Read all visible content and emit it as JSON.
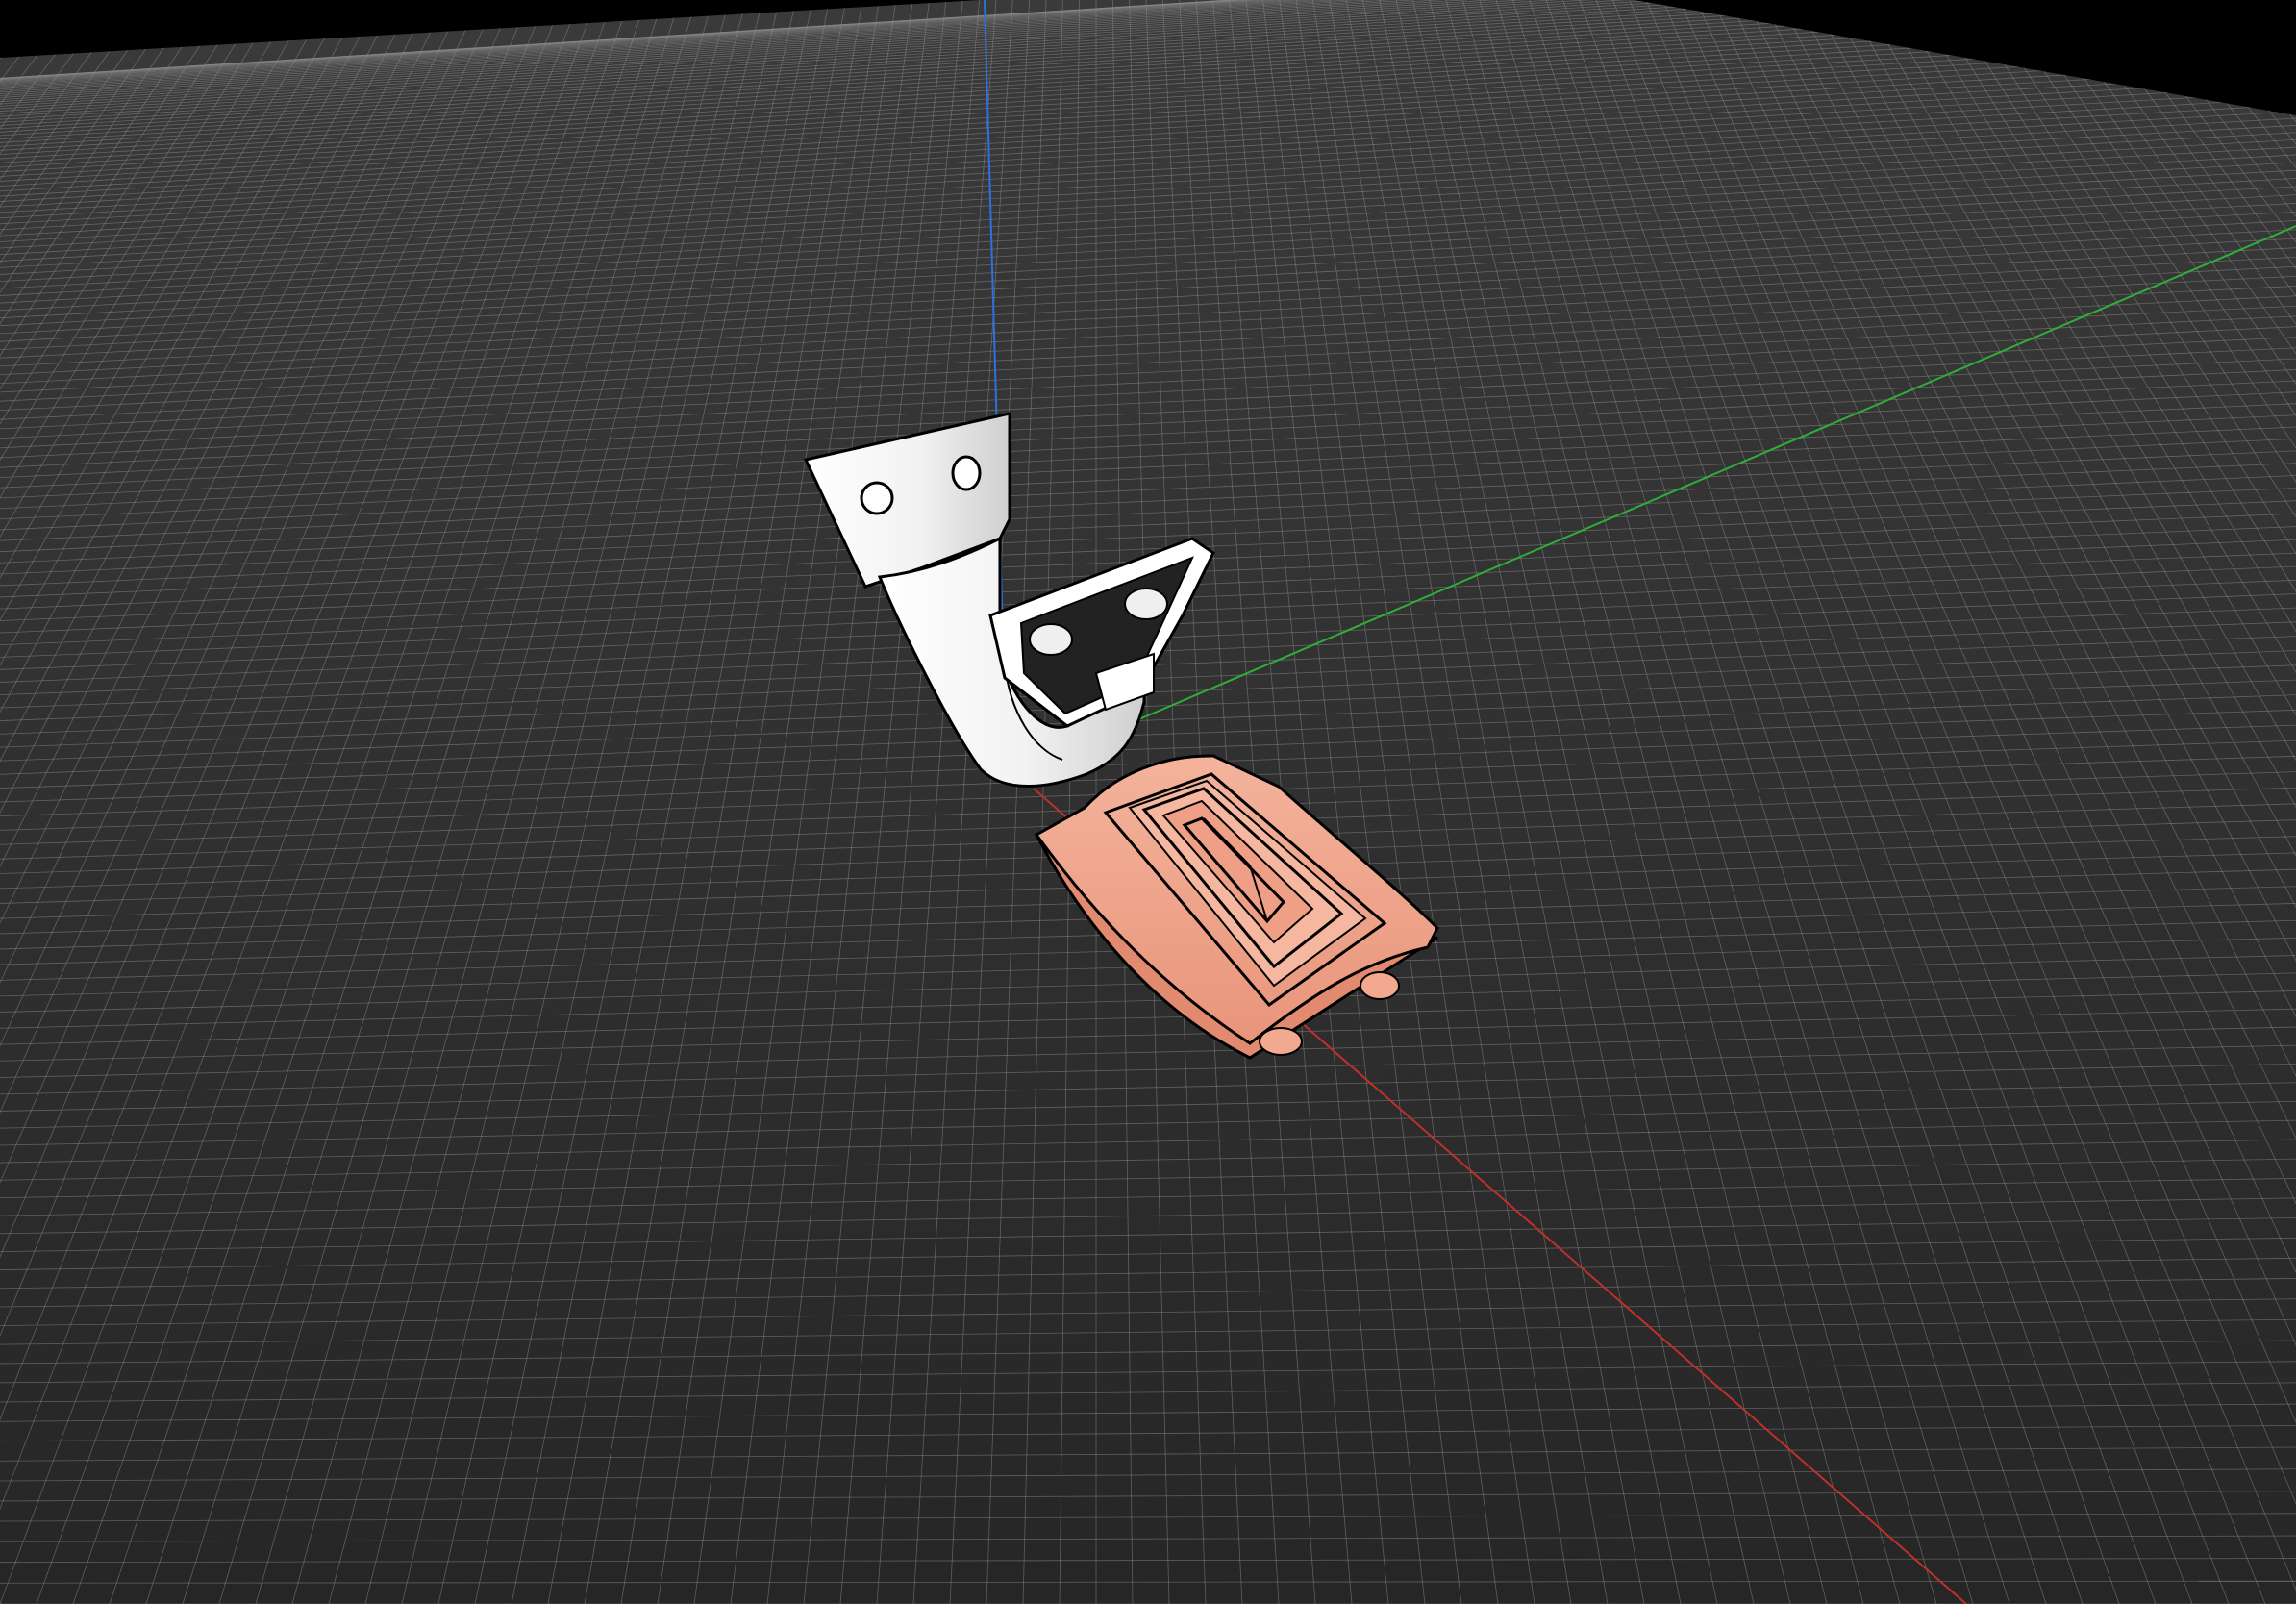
{
  "scene": {
    "background_color": "#000000",
    "floor_color": "#2a2a2a",
    "grid_line_color": "#8c8c8c",
    "axis_colors": {
      "x": "#c0302a",
      "y": "#2fae3a",
      "z": "#2f6fe0"
    },
    "objects": [
      {
        "name": "white-clip-part",
        "color": "#ffffff",
        "outline": "#000000"
      },
      {
        "name": "salmon-spiral-base-part",
        "color": "#f2a98f",
        "outline": "#000000"
      }
    ]
  }
}
